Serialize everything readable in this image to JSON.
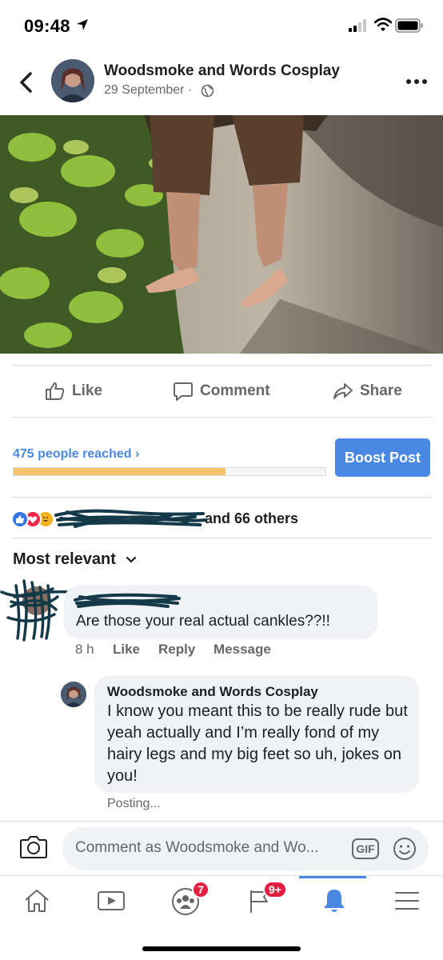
{
  "status_bar": {
    "time": "09:48"
  },
  "post": {
    "page_name": "Woodsmoke and Words Cosplay",
    "date": "29 September",
    "separator": "·"
  },
  "actions": {
    "like": "Like",
    "comment": "Comment",
    "share": "Share"
  },
  "reach": {
    "label": "475 people reached",
    "chevron": "›",
    "progress_fraction": 0.68,
    "boost_label": "Boost Post"
  },
  "reactions": {
    "others_text": "and 66 others"
  },
  "sort": {
    "label": "Most relevant"
  },
  "comments": [
    {
      "text": "Are those your real actual cankles??!!",
      "time": "8 h",
      "like": "Like",
      "reply": "Reply",
      "message": "Message"
    }
  ],
  "reply": {
    "name": "Woodsmoke and Words Cosplay",
    "text": "I know you meant this to be really rude but yeah actually and I’m really fond of my hairy legs and my big feet so uh, jokes on you!",
    "status": "Posting..."
  },
  "comment_input": {
    "placeholder": "Comment as Woodsmoke and Wo...",
    "gif_label": "GIF"
  },
  "tab_bar": {
    "groups_badge": "7",
    "pages_badge": "9+"
  },
  "colors": {
    "accent": "#4a89e3",
    "badge": "#e41e3f",
    "reach_fill": "#f7c46c"
  }
}
